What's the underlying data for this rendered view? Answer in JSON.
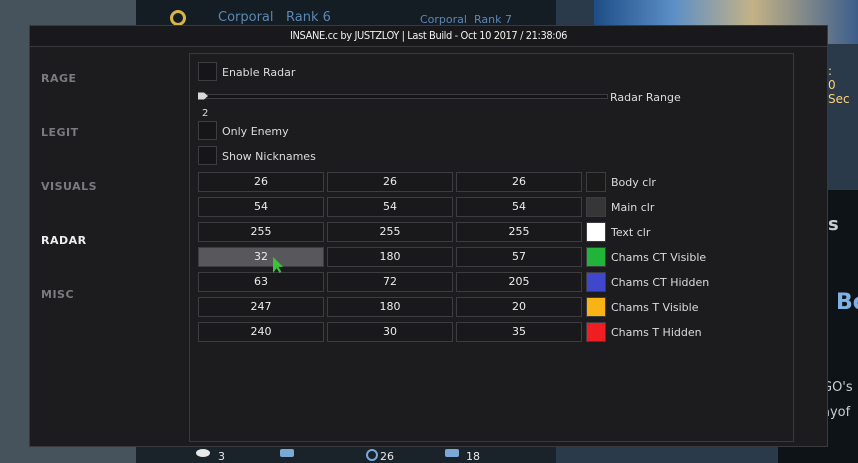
{
  "background": {
    "rank_left": "Corporal",
    "rank_left_num": "Rank 6",
    "rank_right": "Corporal",
    "rank_right_num": "Rank 7",
    "side_sec": "0 Sec",
    "side_colon": ":",
    "side_s": "s",
    "side_bo": "Bo",
    "side_gos": "GO's",
    "side_yof": "ayof",
    "stat_1": "3",
    "stat_2": "26",
    "stat_3": "18"
  },
  "window": {
    "title": "INSANE.cc by JUSTZLOY | Last Build - Oct 10 2017 / 21:38:06"
  },
  "nav": {
    "items": [
      {
        "label": "RAGE",
        "active": false
      },
      {
        "label": "LEGIT",
        "active": false
      },
      {
        "label": "VISUALS",
        "active": false
      },
      {
        "label": "RADAR",
        "active": true
      },
      {
        "label": "MISC",
        "active": false
      }
    ]
  },
  "radar": {
    "enable_label": "Enable Radar",
    "range_label": "Radar Range",
    "range_value": "2",
    "only_enemy_label": "Only Enemy",
    "show_nicknames_label": "Show Nicknames",
    "enable_checked": false,
    "only_enemy_checked": false,
    "show_nicknames_checked": false
  },
  "colors": [
    {
      "r": "26",
      "g": "26",
      "b": "26",
      "label": "Body clr",
      "swatch": "#1a1a1a"
    },
    {
      "r": "54",
      "g": "54",
      "b": "54",
      "label": "Main clr",
      "swatch": "#363636"
    },
    {
      "r": "255",
      "g": "255",
      "b": "255",
      "label": "Text clr",
      "swatch": "#ffffff"
    },
    {
      "r": "32",
      "g": "180",
      "b": "57",
      "label": "Chams CT Visible",
      "swatch": "#20b439"
    },
    {
      "r": "63",
      "g": "72",
      "b": "205",
      "label": "Chams CT Hidden",
      "swatch": "#3f48cd"
    },
    {
      "r": "247",
      "g": "180",
      "b": "20",
      "label": "Chams T Visible",
      "swatch": "#f7b414"
    },
    {
      "r": "240",
      "g": "30",
      "b": "35",
      "label": "Chams T Hidden",
      "swatch": "#f01e23"
    }
  ],
  "selected_field": "colors.3.r"
}
